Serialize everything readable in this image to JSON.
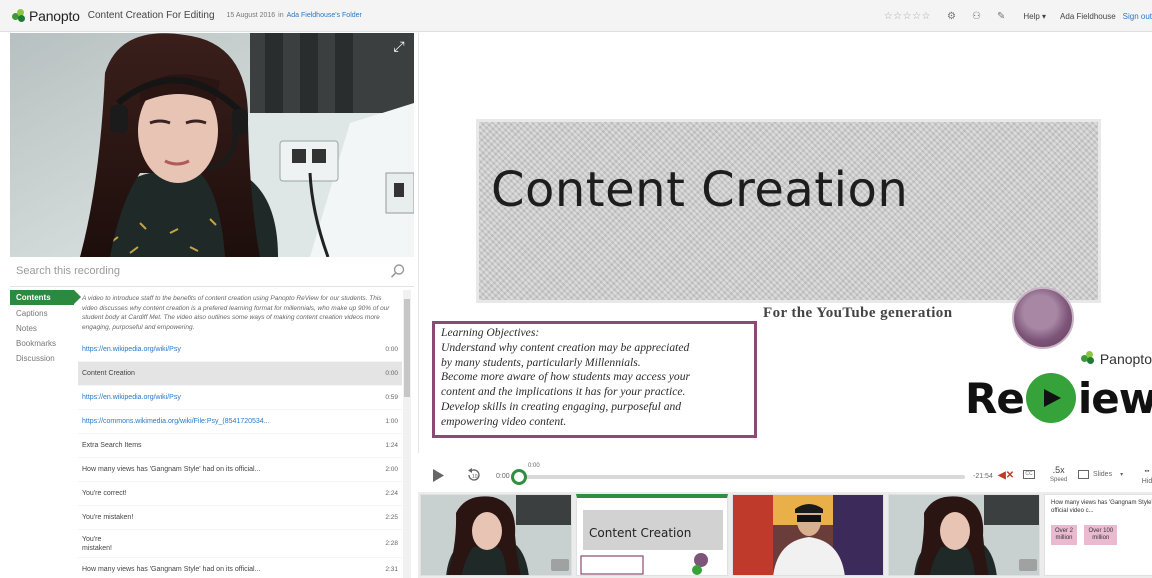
{
  "header": {
    "brand": "Panopto",
    "title": "Content Creation For Editing",
    "date": "15 August 2016",
    "in_word": "in",
    "folder": "Ada Fieldhouse's Folder",
    "rating_stars": "☆☆☆☆☆",
    "help": "Help",
    "user": "Ada Fieldhouse",
    "signout": "Sign out"
  },
  "search": {
    "placeholder": "Search this recording"
  },
  "tabs": [
    {
      "label": "Contents"
    },
    {
      "label": "Captions"
    },
    {
      "label": "Notes"
    },
    {
      "label": "Bookmarks"
    },
    {
      "label": "Discussion"
    }
  ],
  "contents": {
    "description": "A video to introduce staff to the benefits of content creation using Panopto ReView for our students. This video discusses why content creation is a prefered learning format for millennials, who make up 90% of our student body at Cardiff Met. The video also outlines some ways of making content creation videos more engaging, purposeful and empowering.",
    "items": [
      {
        "label": "https://en.wikipedia.org/wiki/Psy",
        "time": "0:00"
      },
      {
        "label": "Content Creation",
        "time": "0:00"
      },
      {
        "label": "https://en.wikipedia.org/wiki/Psy",
        "time": "0:59"
      },
      {
        "label": "https://commons.wikimedia.org/wiki/File:Psy_(8541720534...",
        "time": "1:00"
      },
      {
        "label": "Extra Search Items",
        "time": "1:24"
      },
      {
        "label": "How many views has 'Gangnam Style' had on its official...",
        "time": "2:00"
      },
      {
        "label": "You're correct!",
        "time": "2:24"
      },
      {
        "label": "You're mistaken!",
        "time": "2:25"
      },
      {
        "label": "You're\nmistaken!",
        "time": "2:28"
      },
      {
        "label": "How many views has 'Gangnam Style' had on its official...",
        "time": "2:31"
      }
    ]
  },
  "slide": {
    "title": "Content Creation",
    "subtitle": "For the YouTube generation",
    "objectives": [
      "Learning Objectives:",
      "Understand why content creation may be appreciated",
      "by many students, particularly Millennials.",
      "Become more aware of how students may access your",
      "content and the implications it has for your practice.",
      "Develop skills in creating engaging, purposeful and",
      "empowering video content."
    ],
    "panopto_brand": "Panopto",
    "review_left": "Re",
    "review_right": "iew"
  },
  "player": {
    "time_current": "0:00",
    "time_bubble": "0:00",
    "time_remaining": "-21:54",
    "speed_value": ".5x",
    "speed_label": "Speed",
    "slides_label": "Slides",
    "hide_label": "Hid",
    "cc_label": "CC",
    "progress_fraction": 0.0
  },
  "thumbnails": {
    "slide_title": "Content Creation",
    "question": "How many views has 'Gangnam Style' had on its official video c...",
    "options": [
      "Over 2\nmillion",
      "Over 100\nmillion"
    ]
  }
}
